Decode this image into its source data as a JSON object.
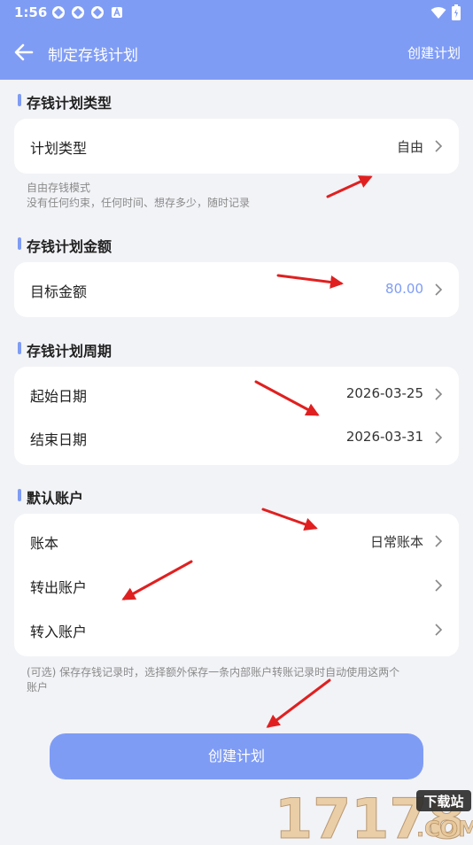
{
  "status_bar": {
    "time": "1:56"
  },
  "nav": {
    "title": "制定存钱计划",
    "action": "创建计划"
  },
  "sections": {
    "type": {
      "title": "存钱计划类型",
      "row": {
        "label": "计划类型",
        "value": "自由"
      },
      "hint_line1": "自由存钱模式",
      "hint_line2": "没有任何约束，任何时间、想存多少，随时记录"
    },
    "amount": {
      "title": "存钱计划金额",
      "row": {
        "label": "目标金额",
        "value": "80.00"
      }
    },
    "period": {
      "title": "存钱计划周期",
      "rows": [
        {
          "label": "起始日期",
          "value": "2026-03-25"
        },
        {
          "label": "结束日期",
          "value": "2026-03-31"
        }
      ]
    },
    "account": {
      "title": "默认账户",
      "rows": [
        {
          "label": "账本",
          "value": "日常账本"
        },
        {
          "label": "转出账户",
          "value": ""
        },
        {
          "label": "转入账户",
          "value": ""
        }
      ],
      "hint_line1": "(可选) 保存存钱记录时，选择额外保存一条内部账户转账记录时自动使用这两个",
      "hint_line2": "账户"
    }
  },
  "create_button": "创建计划",
  "watermark": {
    "number": "17178",
    "tag": "下载站",
    "domain": ".COM"
  },
  "colors": {
    "accent": "#7f9cf5",
    "arrow": "#e02020"
  }
}
